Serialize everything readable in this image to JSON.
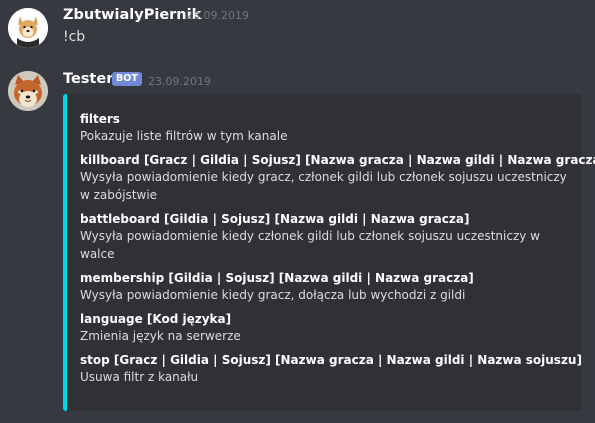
{
  "messages": [
    {
      "author": "ZbutwialyPiernik",
      "timestamp": "23.09.2019",
      "text": "!cb",
      "avatar_icon": "dog-avatar"
    },
    {
      "author": "Tester",
      "badge": "BOT",
      "timestamp": "23.09.2019",
      "avatar_icon": "shiba-avatar",
      "embed": {
        "accent_color": "#00d8e8",
        "fields": [
          {
            "name": "filters",
            "value": "Pokazuje liste filtrów w tym kanale"
          },
          {
            "name": "killboard [Gracz | Gildia | Sojusz] [Nazwa gracza | Nazwa gildi | Nazwa gracza]",
            "value": "Wysyła powiadomienie kiedy gracz, członek gildi lub członek sojuszu uczestniczy w zabójstwie"
          },
          {
            "name": "battleboard [Gildia | Sojusz] [Nazwa gildi | Nazwa gracza]",
            "value": "Wysyła powiadomienie kiedy członek gildi lub członek sojuszu uczestniczy w walce"
          },
          {
            "name": "membership [Gildia | Sojusz] [Nazwa gildi | Nazwa gracza]",
            "value": "Wysyła powiadomienie kiedy gracz, dołącza lub wychodzi z gildi"
          },
          {
            "name": "language [Kod języka]",
            "value": "Zmienia język na serwerze"
          },
          {
            "name": "stop [Gracz | Gildia | Sojusz] [Nazwa gracza | Nazwa gildi | Nazwa sojuszu]",
            "value": "Usuwa filtr z kanału"
          }
        ]
      }
    }
  ],
  "colors": {
    "background": "#36393f",
    "embed_background": "#2f3136",
    "bot_badge": "#7289da",
    "username": "#ffffff",
    "text": "#dcddde",
    "timestamp": "#72767d"
  }
}
